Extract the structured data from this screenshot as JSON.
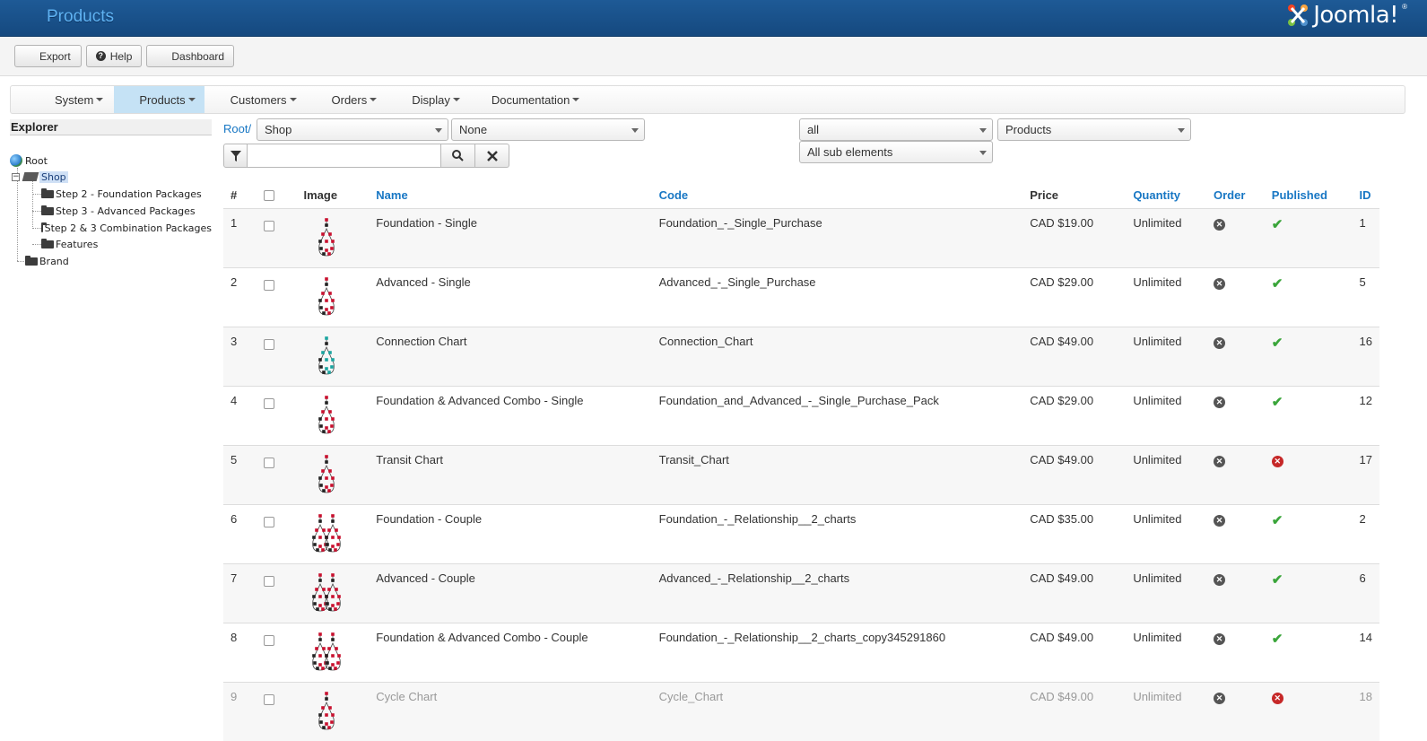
{
  "header": {
    "title": "Products",
    "logo_text": "Joomla!",
    "logo_mark": "®"
  },
  "toolbar": {
    "export_label": "Export",
    "help_label": "Help",
    "dashboard_label": "Dashboard"
  },
  "menu": {
    "items": [
      {
        "label": "System"
      },
      {
        "label": "Products"
      },
      {
        "label": "Customers"
      },
      {
        "label": "Orders"
      },
      {
        "label": "Display"
      },
      {
        "label": "Documentation"
      }
    ],
    "active_index": 1
  },
  "explorer": {
    "title": "Explorer",
    "nodes": [
      {
        "label": "Root"
      },
      {
        "label": "Shop"
      },
      {
        "label": "Step 2 - Foundation Packages"
      },
      {
        "label": "Step 3 - Advanced Packages"
      },
      {
        "label": "Step 2 & 3 Combination Packages"
      },
      {
        "label": "Features"
      },
      {
        "label": "Brand"
      }
    ]
  },
  "filters": {
    "breadcrumb_root": "Root/",
    "category_select": "Shop",
    "none_select": "None",
    "all_select": "all",
    "type_select": "Products",
    "sub_select": "All sub elements",
    "search_placeholder": ""
  },
  "table": {
    "headers": {
      "num": "#",
      "image": "Image",
      "name": "Name",
      "code": "Code",
      "price": "Price",
      "quantity": "Quantity",
      "order": "Order",
      "published": "Published",
      "id": "ID"
    },
    "rows": [
      {
        "num": "1",
        "name": "Foundation - Single",
        "code": "Foundation_-_Single_Purchase",
        "price": "CAD $19.00",
        "quantity": "Unlimited",
        "published": true,
        "id": "1",
        "image": "single-red"
      },
      {
        "num": "2",
        "name": "Advanced - Single",
        "code": "Advanced_-_Single_Purchase",
        "price": "CAD $29.00",
        "quantity": "Unlimited",
        "published": true,
        "id": "5",
        "image": "single-red"
      },
      {
        "num": "3",
        "name": "Connection Chart",
        "code": "Connection_Chart",
        "price": "CAD $49.00",
        "quantity": "Unlimited",
        "published": true,
        "id": "16",
        "image": "single-teal"
      },
      {
        "num": "4",
        "name": "Foundation & Advanced Combo - Single",
        "code": "Foundation_and_Advanced_-_Single_Purchase_Pack",
        "price": "CAD $29.00",
        "quantity": "Unlimited",
        "published": true,
        "id": "12",
        "image": "single-red"
      },
      {
        "num": "5",
        "name": "Transit Chart",
        "code": "Transit_Chart",
        "price": "CAD $49.00",
        "quantity": "Unlimited",
        "published": false,
        "id": "17",
        "image": "single-red"
      },
      {
        "num": "6",
        "name": "Foundation - Couple",
        "code": "Foundation_-_Relationship__2_charts",
        "price": "CAD $35.00",
        "quantity": "Unlimited",
        "published": true,
        "id": "2",
        "image": "couple"
      },
      {
        "num": "7",
        "name": "Advanced - Couple",
        "code": "Advanced_-_Relationship__2_charts",
        "price": "CAD $49.00",
        "quantity": "Unlimited",
        "published": true,
        "id": "6",
        "image": "couple"
      },
      {
        "num": "8",
        "name": "Foundation & Advanced Combo - Couple",
        "code": "Foundation_-_Relationship__2_charts_copy345291860",
        "price": "CAD $49.00",
        "quantity": "Unlimited",
        "published": true,
        "id": "14",
        "image": "couple"
      },
      {
        "num": "9",
        "name": "Cycle Chart",
        "code": "Cycle_Chart",
        "price": "CAD $49.00",
        "quantity": "Unlimited",
        "published": false,
        "id": "18",
        "image": "single-red"
      }
    ]
  },
  "icons": {
    "order_icon": "circle-x-icon",
    "published_yes": "checkmark-icon",
    "published_no": "red-x-icon"
  },
  "colors": {
    "header_bg": "#15497f",
    "link": "#1877c4",
    "active_menu": "#c5e2f5",
    "publish_green": "#3aa53a",
    "unpublish_red": "#c62828"
  }
}
